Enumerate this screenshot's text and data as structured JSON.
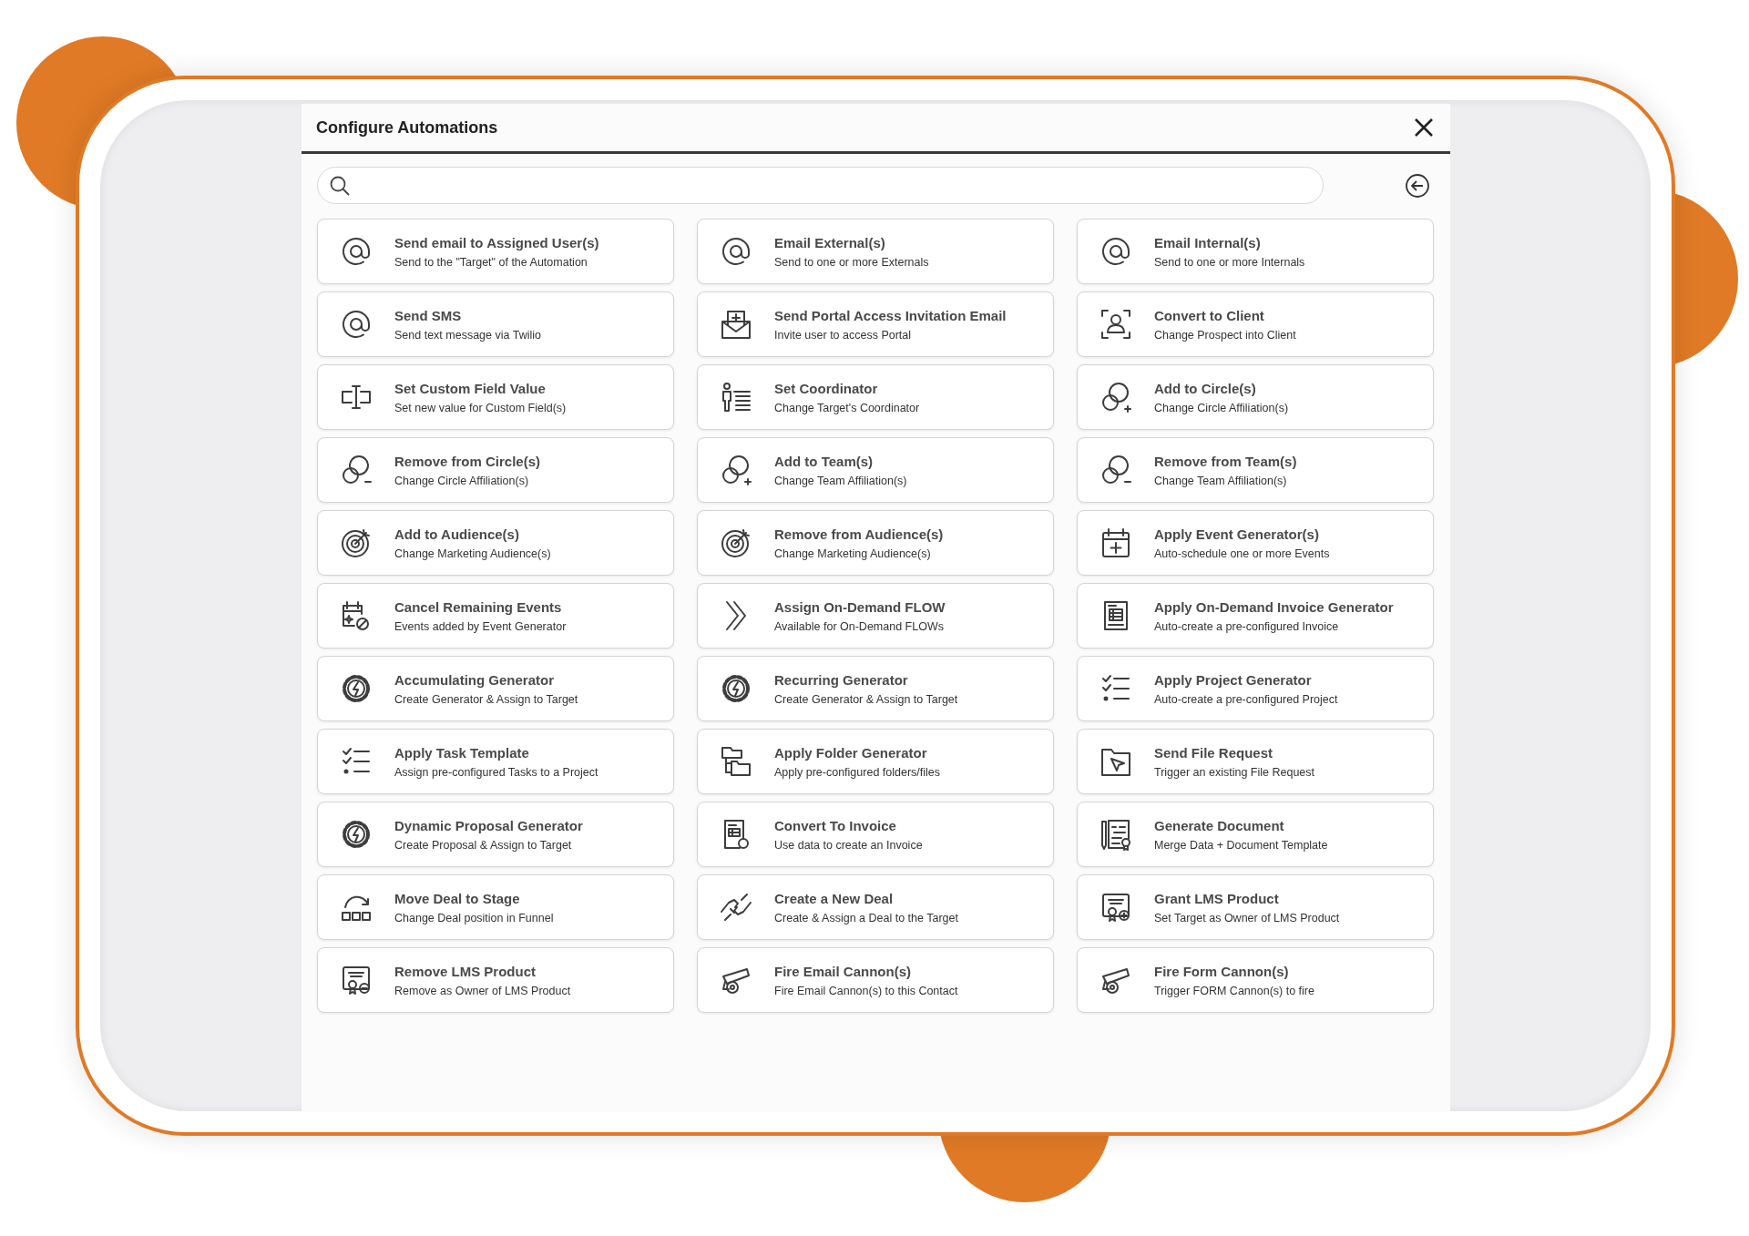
{
  "dialog": {
    "title": "Configure Automations"
  },
  "automations": [
    {
      "title": "Send email to Assigned User(s)",
      "description": "Send to the \"Target\" of the Automation"
    },
    {
      "title": "Email External(s)",
      "description": "Send to one or more Externals"
    },
    {
      "title": "Email Internal(s)",
      "description": "Send to one or more Internals"
    },
    {
      "title": "Send SMS",
      "description": "Send text message via Twilio"
    },
    {
      "title": "Send Portal Access Invitation Email",
      "description": "Invite user to access Portal"
    },
    {
      "title": "Convert to Client",
      "description": "Change Prospect into Client"
    },
    {
      "title": "Set Custom Field Value",
      "description": "Set new value for Custom Field(s)"
    },
    {
      "title": "Set Coordinator",
      "description": "Change Target's Coordinator"
    },
    {
      "title": "Add to Circle(s)",
      "description": "Change Circle Affiliation(s)"
    },
    {
      "title": "Remove from Circle(s)",
      "description": "Change Circle Affiliation(s)"
    },
    {
      "title": "Add to Team(s)",
      "description": "Change Team Affiliation(s)"
    },
    {
      "title": "Remove from Team(s)",
      "description": "Change Team Affiliation(s)"
    },
    {
      "title": "Add to Audience(s)",
      "description": "Change Marketing Audience(s)"
    },
    {
      "title": "Remove from Audience(s)",
      "description": "Change Marketing Audience(s)"
    },
    {
      "title": "Apply Event Generator(s)",
      "description": "Auto-schedule one or more Events"
    },
    {
      "title": "Cancel Remaining Events",
      "description": "Events added by Event Generator"
    },
    {
      "title": "Assign On-Demand FLOW",
      "description": "Available for On-Demand FLOWs"
    },
    {
      "title": "Apply On-Demand Invoice Generator",
      "description": "Auto-create a pre-configured Invoice"
    },
    {
      "title": "Accumulating Generator",
      "description": "Create Generator & Assign to Target"
    },
    {
      "title": "Recurring Generator",
      "description": "Create Generator & Assign to Target"
    },
    {
      "title": "Apply Project Generator",
      "description": "Auto-create a pre-configured Project"
    },
    {
      "title": "Apply Task Template",
      "description": "Assign pre-configured Tasks to a Project"
    },
    {
      "title": "Apply Folder Generator",
      "description": "Apply pre-configured folders/files"
    },
    {
      "title": "Send File Request",
      "description": "Trigger an existing File Request"
    },
    {
      "title": "Dynamic Proposal Generator",
      "description": "Create Proposal & Assign to Target"
    },
    {
      "title": "Convert To Invoice",
      "description": "Use data to create an Invoice"
    },
    {
      "title": "Generate Document",
      "description": "Merge Data + Document Template"
    },
    {
      "title": "Move Deal to Stage",
      "description": "Change Deal position in Funnel"
    },
    {
      "title": "Create a New Deal",
      "description": "Create & Assign a Deal to the Target"
    },
    {
      "title": "Grant LMS Product",
      "description": "Set Target as Owner of LMS Product"
    },
    {
      "title": "Remove LMS Product",
      "description": "Remove as Owner of LMS Product"
    },
    {
      "title": "Fire Email Cannon(s)",
      "description": "Fire Email Cannon(s) to this Contact"
    },
    {
      "title": "Fire Form Cannon(s)",
      "description": "Trigger FORM Cannon(s) to fire"
    }
  ]
}
